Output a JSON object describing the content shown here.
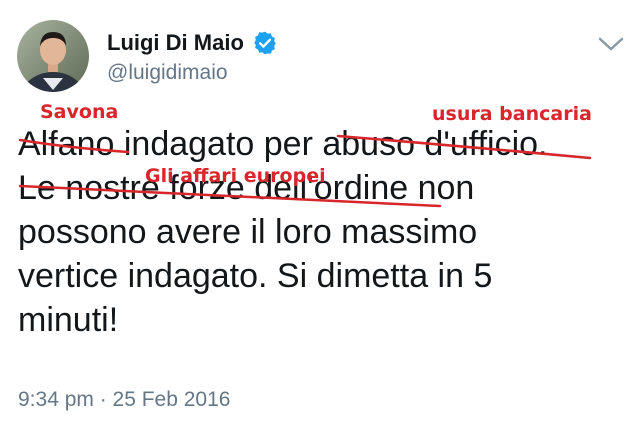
{
  "author": {
    "name": "Luigi Di Maio",
    "handle": "@luigidimaio",
    "avatar_icon": "profile-photo",
    "verified_icon": "verified-badge-icon",
    "verified_color": "#1da1f2"
  },
  "tweet": {
    "lines": [
      "Alfano indagato per abuso d'ufficio.",
      "Le nostre forze dell'ordine non",
      "possono avere il loro massimo",
      "vertice indagato. Si dimetta in 5",
      "minuti!"
    ],
    "timestamp": "9:34 pm · 25 Feb 2016"
  },
  "annotations": {
    "savona": "Savona",
    "usura": "usura bancaria",
    "affari": "Gli affari europei",
    "ink_color": "#d8262b"
  },
  "controls": {
    "menu_icon": "chevron-down-icon"
  }
}
